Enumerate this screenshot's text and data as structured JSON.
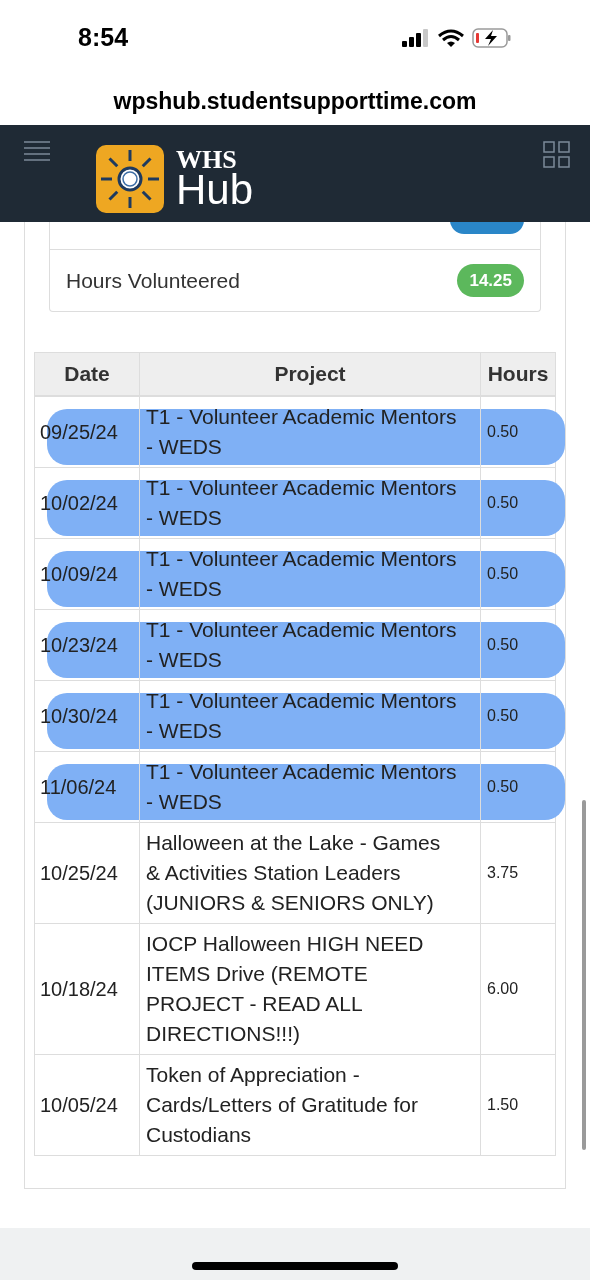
{
  "status_bar": {
    "time": "8:54"
  },
  "browser": {
    "url": "wpshub.studentsupporttime.com"
  },
  "header": {
    "logo_top": "WHS",
    "logo_bottom": "Hub"
  },
  "stats": [
    {
      "label": "Hours Volunteered",
      "value": "14.25"
    }
  ],
  "table": {
    "columns": [
      "Date",
      "Project",
      "Hours"
    ],
    "rows": [
      {
        "date": "09/25/24",
        "project": "T1 - Volunteer Academic Mentors - WEDS",
        "hours": "0.50",
        "highlighted": true
      },
      {
        "date": "10/02/24",
        "project": "T1 - Volunteer Academic Mentors - WEDS",
        "hours": "0.50",
        "highlighted": true
      },
      {
        "date": "10/09/24",
        "project": "T1 - Volunteer Academic Mentors - WEDS",
        "hours": "0.50",
        "highlighted": true
      },
      {
        "date": "10/23/24",
        "project": "T1 - Volunteer Academic Mentors - WEDS",
        "hours": "0.50",
        "highlighted": true
      },
      {
        "date": "10/30/24",
        "project": "T1 - Volunteer Academic Mentors - WEDS",
        "hours": "0.50",
        "highlighted": true
      },
      {
        "date": "11/06/24",
        "project": "T1 - Volunteer Academic Mentors - WEDS",
        "hours": "0.50",
        "highlighted": true
      },
      {
        "date": "10/25/24",
        "project": "Halloween at the Lake - Games & Activities Station Leaders (JUNIORS & SENIORS ONLY)",
        "hours": "3.75",
        "highlighted": false
      },
      {
        "date": "10/18/24",
        "project": "IOCP Halloween HIGH NEED ITEMS Drive (REMOTE PROJECT - READ ALL DIRECTIONS!!!)",
        "hours": "6.00",
        "highlighted": false
      },
      {
        "date": "10/05/24",
        "project": "Token of Appreciation - Cards/Letters of Gratitude for Custodians",
        "hours": "1.50",
        "highlighted": false
      }
    ]
  }
}
